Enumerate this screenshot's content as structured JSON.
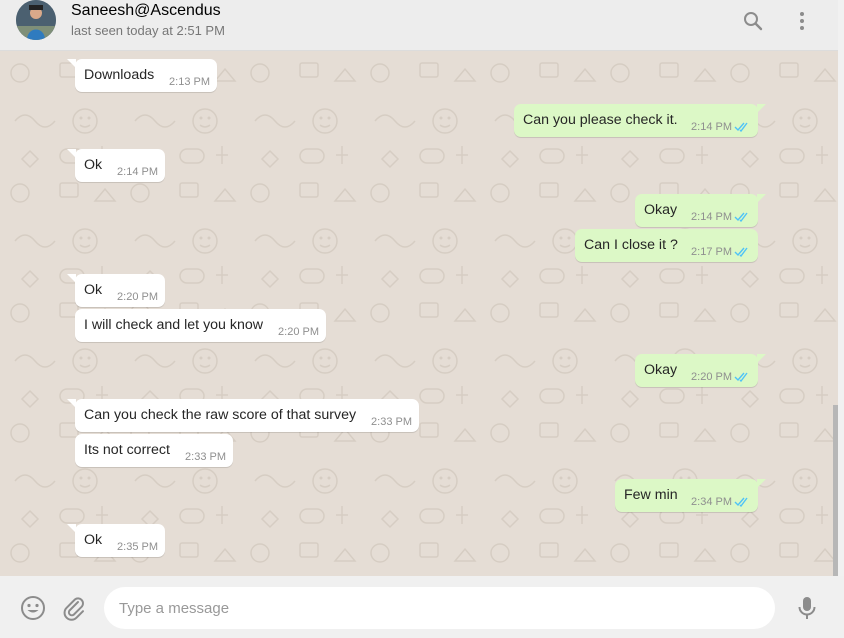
{
  "header": {
    "contact_name": "Saneesh@Ascendus",
    "last_seen": "last seen today at 2:51 PM"
  },
  "icons": {
    "search": "search-icon",
    "menu": "menu-icon",
    "emoji": "emoji-icon",
    "attach": "paperclip-icon",
    "mic": "microphone-icon",
    "read_ticks": "double-check-icon"
  },
  "colors": {
    "incoming_bubble": "#ffffff",
    "outgoing_bubble": "#dcf8c6",
    "read_ticks": "#4fc3f7",
    "chat_background": "#e5ddd5"
  },
  "messages": [
    {
      "dir": "in",
      "text": "Downloads",
      "time": "2:13 PM"
    },
    {
      "dir": "out",
      "text": "Can you please check it.",
      "time": "2:14 PM"
    },
    {
      "dir": "in",
      "text": "Ok",
      "time": "2:14 PM"
    },
    {
      "dir": "out",
      "text": "Okay",
      "time": "2:14 PM"
    },
    {
      "dir": "out",
      "text": "Can I close it ?",
      "time": "2:17 PM"
    },
    {
      "dir": "in",
      "text": "Ok",
      "time": "2:20 PM"
    },
    {
      "dir": "in",
      "text": "I will check and let you know",
      "time": "2:20 PM"
    },
    {
      "dir": "out",
      "text": "Okay",
      "time": "2:20 PM"
    },
    {
      "dir": "in",
      "text": "Can you check the raw score of that survey",
      "time": "2:33 PM"
    },
    {
      "dir": "in",
      "text": "Its not correct",
      "time": "2:33 PM"
    },
    {
      "dir": "out",
      "text": "Few min",
      "time": "2:34 PM"
    },
    {
      "dir": "in",
      "text": "Ok",
      "time": "2:35 PM"
    }
  ],
  "composer": {
    "placeholder": "Type a message",
    "value": ""
  }
}
